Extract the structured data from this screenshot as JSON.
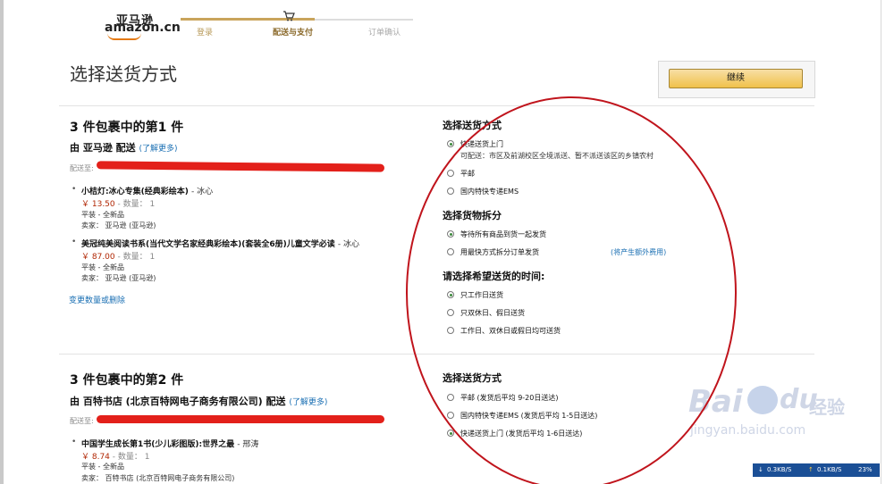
{
  "header": {
    "logo_cn": "亚马逊",
    "logo_en": "amazon.cn",
    "steps": [
      "登录",
      "配送与支付",
      "订单确认"
    ],
    "cart_icon": "cart-icon"
  },
  "page": {
    "title": "选择送货方式",
    "continue_label": "继续"
  },
  "package1": {
    "heading": "3 件包裹中的第1 件",
    "by_label": "由 亚马逊 配送",
    "learn_more": "(了解更多)",
    "ship_to_label": "配送至:",
    "items": [
      {
        "title": "小桔灯:冰心专集(经典彩绘本)",
        "author": "- 冰心",
        "price": "￥ 13.50",
        "qty": "- 数量： 1",
        "binding": "平装 - 全新品",
        "seller": "卖家： 亚马逊 (亚马逊)"
      },
      {
        "title": "美冠纯美阅读书系(当代文学名家经典彩绘本)(套装全6册)儿童文学必读",
        "author": "- 冰心",
        "price": "￥ 87.00",
        "qty": "- 数量： 1",
        "binding": "平装 - 全新品",
        "seller": "卖家： 亚马逊 (亚马逊)"
      }
    ],
    "change_link": "变更数量或删除",
    "shipping_heading": "选择送货方式",
    "shipping_options": [
      {
        "label": "快递送货上门",
        "selected": true,
        "note": "可配送：市区及前湖校区全境派送、暂不派送该区的乡镇农村"
      },
      {
        "label": "平邮",
        "selected": false
      },
      {
        "label": "国内特快专递EMS",
        "selected": false
      }
    ],
    "split_heading": "选择货物拆分",
    "split_options": [
      {
        "label": "等待所有商品到货一起发货",
        "selected": true
      },
      {
        "label": "用最快方式拆分订单发货(将产生额外费用)",
        "extra": "(将产生额外费用)",
        "selected": false
      }
    ],
    "time_heading": "请选择希望送货的时间:",
    "time_options": [
      {
        "label": "只工作日送货",
        "selected": true
      },
      {
        "label": "只双休日、假日送货",
        "selected": false
      },
      {
        "label": "工作日、双休日或假日均可送货",
        "selected": false
      }
    ]
  },
  "package2": {
    "heading": "3 件包裹中的第2 件",
    "by_label": "由 百特书店 (北京百特网电子商务有限公司) 配送",
    "learn_more": "(了解更多)",
    "ship_to_label": "配送至:",
    "items": [
      {
        "title": "中国学生成长第1书(少儿彩图版):世界之最",
        "author": "- 邢涛",
        "price": "￥ 8.74",
        "qty": "- 数量： 1",
        "binding": "平装 - 全新品",
        "seller": "卖家： 百特书店 (北京百特网电子商务有限公司)"
      }
    ],
    "shipping_heading": "选择送货方式",
    "shipping_options": [
      {
        "label": "平邮 (发货后平均 9-20日送达)",
        "selected": false
      },
      {
        "label": "国内特快专递EMS (发货后平均 1-5日送达)",
        "selected": false
      },
      {
        "label": "快递送货上门 (发货后平均 1-6日送达)",
        "selected": true
      }
    ]
  },
  "overlay": {
    "annotation_color": "#c0141c",
    "redaction_color": "#e3201a"
  },
  "watermark": {
    "text_en": "Bai",
    "text_du": "du",
    "text_cn": "经验",
    "url": "jingyan.baidu.com"
  },
  "netbar": {
    "down": "0.3KB/S",
    "up": "0.1KB/S",
    "pct": "23%"
  }
}
